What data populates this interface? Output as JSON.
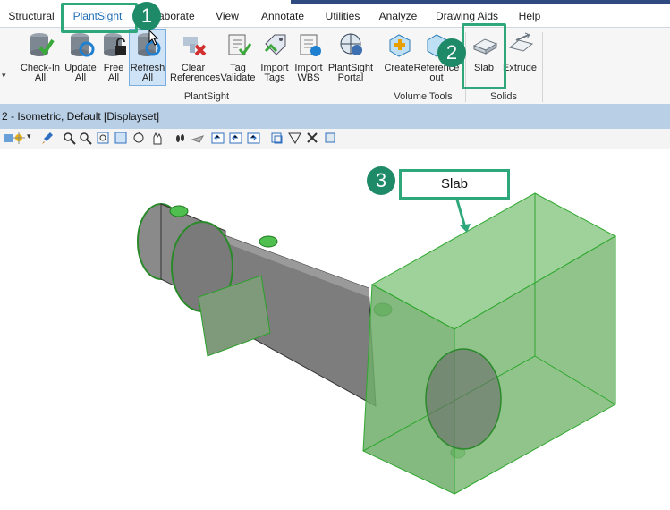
{
  "tabs": [
    "Structural",
    "PlantSight",
    "laborate",
    "View",
    "Annotate",
    "Utilities",
    "Analyze",
    "Drawing Aids",
    "Help"
  ],
  "active_tab": "PlantSight",
  "ribbon": {
    "buttons": [
      {
        "id": "checkin",
        "label": "Check-In\nAll"
      },
      {
        "id": "update",
        "label": "Update\nAll"
      },
      {
        "id": "free",
        "label": "Free\nAll"
      },
      {
        "id": "refresh",
        "label": "Refresh\nAll"
      },
      {
        "id": "clear",
        "label": "Clear\nReferences"
      },
      {
        "id": "tag",
        "label": "Tag\nValidate"
      },
      {
        "id": "importtags",
        "label": "Import\nTags"
      },
      {
        "id": "importwbs",
        "label": "Import\nWBS"
      },
      {
        "id": "portal",
        "label": "PlantSight\nPortal"
      },
      {
        "id": "create",
        "label": "Create"
      },
      {
        "id": "refout",
        "label": "Reference\nout"
      },
      {
        "id": "slab",
        "label": "Slab"
      },
      {
        "id": "extrude",
        "label": "Extrude"
      }
    ],
    "groups": [
      "PlantSight",
      "Volume Tools",
      "Solids"
    ]
  },
  "view_title": "2 - Isometric, Default [Displayset]",
  "callouts": [
    "1",
    "2",
    "3"
  ],
  "slab_label": "Slab",
  "colors": {
    "accent": "#2ea87a",
    "callout": "#1e8a68",
    "slab": "#6fbf6a"
  }
}
